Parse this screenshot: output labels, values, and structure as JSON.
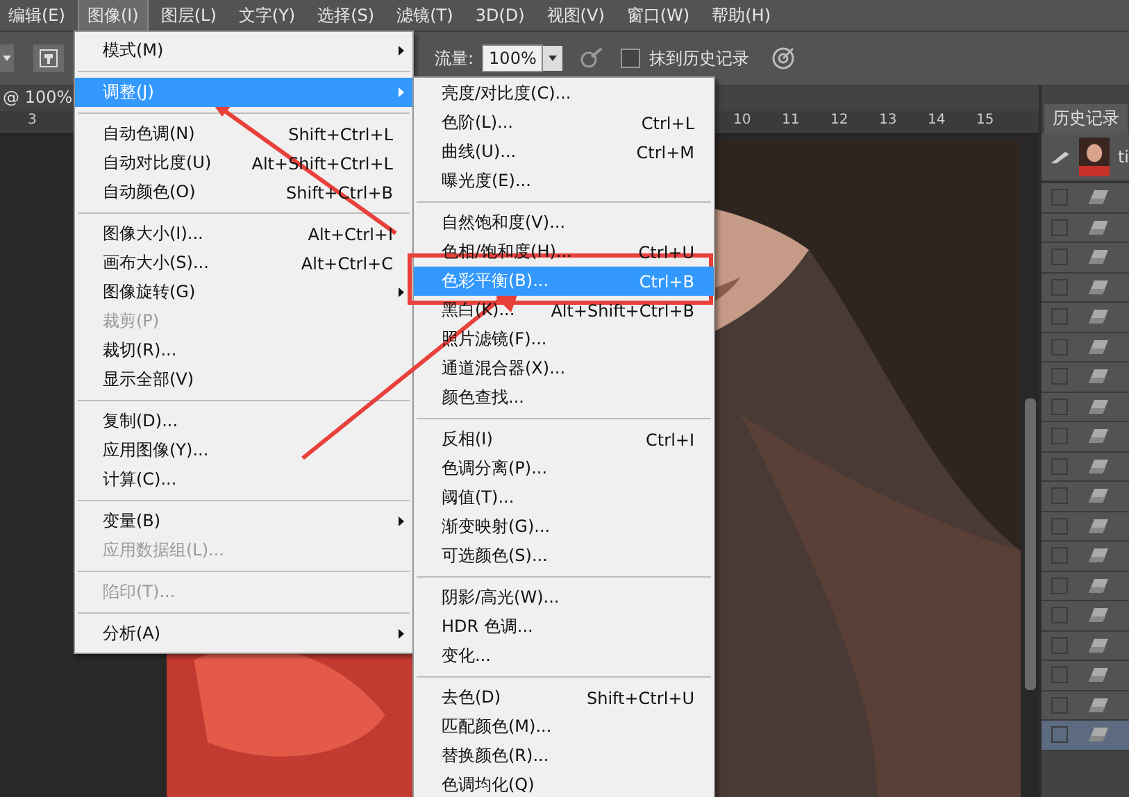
{
  "menubar": [
    {
      "label": "编辑(E)",
      "selected": false
    },
    {
      "label": "图像(I)",
      "selected": true
    },
    {
      "label": "图层(L)",
      "selected": false
    },
    {
      "label": "文字(Y)",
      "selected": false
    },
    {
      "label": "选择(S)",
      "selected": false
    },
    {
      "label": "滤镜(T)",
      "selected": false
    },
    {
      "label": "3D(D)",
      "selected": false
    },
    {
      "label": "视图(V)",
      "selected": false
    },
    {
      "label": "窗口(W)",
      "selected": false
    },
    {
      "label": "帮助(H)",
      "selected": false
    }
  ],
  "options_bar": {
    "flow_label": "流量:",
    "flow_value": "100%",
    "erase_history": {
      "label": "抹到历史记录",
      "checked": false
    }
  },
  "document_tab": "@ 100%",
  "ruler": [
    "3",
    "10",
    "11",
    "12",
    "13",
    "14",
    "15"
  ],
  "image_menu": [
    [
      {
        "label": "模式(M)",
        "submenu": true,
        "selected": false,
        "disabled": false
      }
    ],
    [
      {
        "label": "调整(J)",
        "submenu": true,
        "selected": true,
        "disabled": false
      }
    ],
    [
      {
        "label": "自动色调(N)",
        "shortcut": "Shift+Ctrl+L",
        "selected": false,
        "disabled": false
      },
      {
        "label": "自动对比度(U)",
        "shortcut": "Alt+Shift+Ctrl+L",
        "selected": false,
        "disabled": false
      },
      {
        "label": "自动颜色(O)",
        "shortcut": "Shift+Ctrl+B",
        "selected": false,
        "disabled": false
      }
    ],
    [
      {
        "label": "图像大小(I)...",
        "shortcut": "Alt+Ctrl+I",
        "selected": false,
        "disabled": false
      },
      {
        "label": "画布大小(S)...",
        "shortcut": "Alt+Ctrl+C",
        "selected": false,
        "disabled": false
      },
      {
        "label": "图像旋转(G)",
        "submenu": true,
        "selected": false,
        "disabled": false
      },
      {
        "label": "裁剪(P)",
        "selected": false,
        "disabled": true
      },
      {
        "label": "裁切(R)...",
        "selected": false,
        "disabled": false
      },
      {
        "label": "显示全部(V)",
        "selected": false,
        "disabled": false
      }
    ],
    [
      {
        "label": "复制(D)...",
        "selected": false,
        "disabled": false
      },
      {
        "label": "应用图像(Y)...",
        "selected": false,
        "disabled": false
      },
      {
        "label": "计算(C)...",
        "selected": false,
        "disabled": false
      }
    ],
    [
      {
        "label": "变量(B)",
        "submenu": true,
        "selected": false,
        "disabled": false
      },
      {
        "label": "应用数据组(L)...",
        "selected": false,
        "disabled": true
      }
    ],
    [
      {
        "label": "陷印(T)...",
        "selected": false,
        "disabled": true
      }
    ],
    [
      {
        "label": "分析(A)",
        "submenu": true,
        "selected": false,
        "disabled": false
      }
    ]
  ],
  "adjust_submenu": [
    [
      {
        "label": "亮度/对比度(C)...",
        "selected": false
      },
      {
        "label": "色阶(L)...",
        "shortcut": "Ctrl+L",
        "selected": false
      },
      {
        "label": "曲线(U)...",
        "shortcut": "Ctrl+M",
        "selected": false
      },
      {
        "label": "曝光度(E)...",
        "selected": false
      }
    ],
    [
      {
        "label": "自然饱和度(V)...",
        "selected": false
      },
      {
        "label": "色相/饱和度(H)...",
        "shortcut": "Ctrl+U",
        "selected": false
      },
      {
        "label": "色彩平衡(B)...",
        "shortcut": "Ctrl+B",
        "selected": true
      },
      {
        "label": "黑白(K)...",
        "shortcut": "Alt+Shift+Ctrl+B",
        "selected": false
      },
      {
        "label": "照片滤镜(F)...",
        "selected": false
      },
      {
        "label": "通道混合器(X)...",
        "selected": false
      },
      {
        "label": "颜色查找...",
        "selected": false
      }
    ],
    [
      {
        "label": "反相(I)",
        "shortcut": "Ctrl+I",
        "selected": false
      },
      {
        "label": "色调分离(P)...",
        "selected": false
      },
      {
        "label": "阈值(T)...",
        "selected": false
      },
      {
        "label": "渐变映射(G)...",
        "selected": false
      },
      {
        "label": "可选颜色(S)...",
        "selected": false
      }
    ],
    [
      {
        "label": "阴影/高光(W)...",
        "selected": false
      },
      {
        "label": "HDR 色调...",
        "selected": false
      },
      {
        "label": "变化...",
        "selected": false
      }
    ],
    [
      {
        "label": "去色(D)",
        "shortcut": "Shift+Ctrl+U",
        "selected": false
      },
      {
        "label": "匹配颜色(M)...",
        "selected": false
      },
      {
        "label": "替换颜色(R)...",
        "selected": false
      },
      {
        "label": "色调均化(Q)",
        "selected": false
      }
    ]
  ],
  "history_panel": {
    "tab": "历史记录",
    "snapshot": "ti",
    "steps": [
      {
        "selected": false
      },
      {
        "selected": false
      },
      {
        "selected": false
      },
      {
        "selected": false
      },
      {
        "selected": false
      },
      {
        "selected": false
      },
      {
        "selected": false
      },
      {
        "selected": false
      },
      {
        "selected": false
      },
      {
        "selected": false
      },
      {
        "selected": false
      },
      {
        "selected": false
      },
      {
        "selected": false
      },
      {
        "selected": false
      },
      {
        "selected": false
      },
      {
        "selected": false
      },
      {
        "selected": false
      },
      {
        "selected": false
      },
      {
        "selected": true
      }
    ]
  }
}
